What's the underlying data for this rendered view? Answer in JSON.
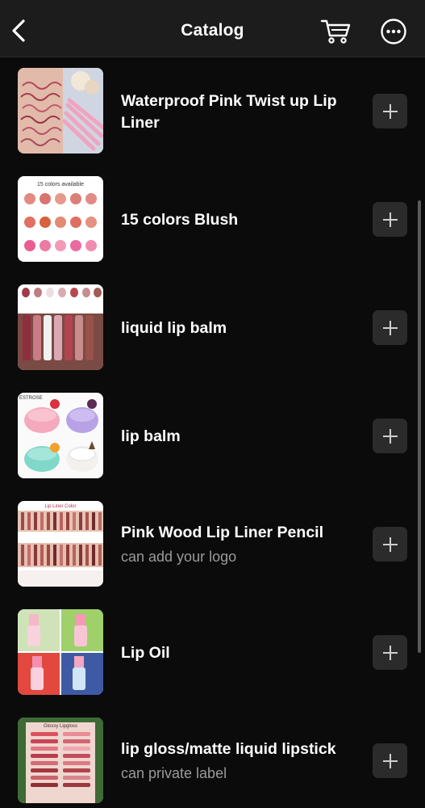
{
  "header": {
    "title": "Catalog",
    "back_icon": "chevron-left-icon",
    "cart_icon": "cart-icon",
    "more_icon": "more-options-icon"
  },
  "products": [
    {
      "name": "Waterproof Pink Twist up Lip Liner",
      "subtitle": "",
      "thumb_icon": "lip-liner-swatch-image"
    },
    {
      "name": "15 colors Blush",
      "subtitle": "",
      "thumb_icon": "blush-palette-image",
      "thumb_caption": "15 colors available"
    },
    {
      "name": "liquid lip balm",
      "subtitle": "",
      "thumb_icon": "lip-balm-tubes-image"
    },
    {
      "name": "lip balm",
      "subtitle": "",
      "thumb_icon": "lip-balm-jars-image",
      "thumb_caption": "ESTROSE"
    },
    {
      "name": "Pink Wood Lip Liner Pencil",
      "subtitle": "can add your logo",
      "thumb_icon": "lip-liner-chart-image",
      "thumb_caption": "Lip Liner Color"
    },
    {
      "name": "Lip Oil",
      "subtitle": "",
      "thumb_icon": "lip-oil-bottles-image"
    },
    {
      "name": "lip gloss/matte liquid lipstick",
      "subtitle": "can private label",
      "thumb_icon": "lip-gloss-swatch-image",
      "thumb_caption": "Glossy Lipgloss"
    }
  ],
  "add_icon": "plus-icon",
  "colors": {
    "background": "#0b0b0b",
    "header": "#1c1c1c",
    "add_button": "#2b2b2b",
    "subtitle": "#9a9a9a"
  }
}
